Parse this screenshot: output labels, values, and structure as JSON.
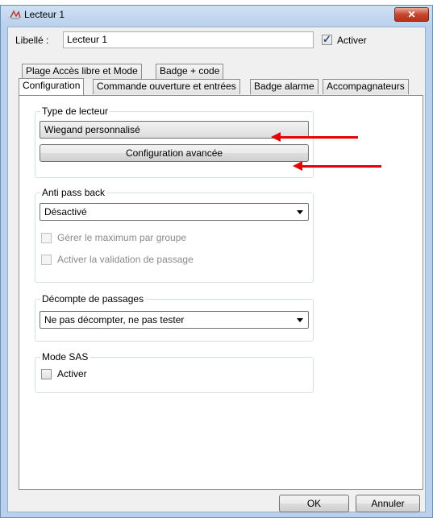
{
  "window": {
    "title": "Lecteur 1",
    "close_glyph": "✕"
  },
  "header": {
    "label": "Libellé :",
    "name_value": "Lecteur 1",
    "activate_label": "Activer",
    "activate_checked": true
  },
  "tabs_row1": [
    "Plage Accès libre et Mode",
    "Badge + code"
  ],
  "tabs_row2": [
    "Configuration",
    "Commande ouverture et entrées",
    "Badge alarme",
    "Accompagnateurs"
  ],
  "active_tab": "Configuration",
  "reader_type": {
    "legend": "Type de lecteur",
    "selected": "Wiegand personnalisé",
    "advanced_button": "Configuration avancée"
  },
  "anti_pass_back": {
    "legend": "Anti pass back",
    "selected": "Désactivé",
    "options": [
      {
        "label": "Gérer le maximum par groupe",
        "checked": false,
        "enabled": false
      },
      {
        "label": "Activer la validation de passage",
        "checked": false,
        "enabled": false
      }
    ]
  },
  "pass_count": {
    "legend": "Décompte de passages",
    "selected": "Ne pas décompter, ne pas tester"
  },
  "sas_mode": {
    "legend": "Mode SAS",
    "activate_label": "Activer",
    "checked": false
  },
  "footer": {
    "ok_label": "OK",
    "cancel_label": "Annuler"
  },
  "annotations": {
    "arrow_color": "#e60000"
  }
}
